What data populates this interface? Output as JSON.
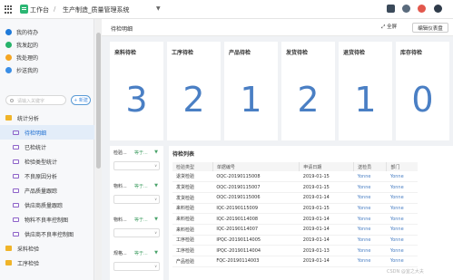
{
  "topbar": {
    "workspace": "工作台",
    "separator": "/",
    "system": "生产制造_质量管理系统",
    "icons": [
      "grid-icon",
      "document-icon",
      "user-icon",
      "notification-icon",
      "help-icon"
    ]
  },
  "sidebar": {
    "top_items": [
      {
        "label": "我的待办",
        "color": "#1f7ad9"
      },
      {
        "label": "我发起的",
        "color": "#27b36b"
      },
      {
        "label": "我处理的",
        "color": "#f5a623"
      },
      {
        "label": "抄送我的",
        "color": "#3a8ee6"
      }
    ],
    "search_placeholder": "请输入关键字",
    "new_button": "+ 新建",
    "tree": [
      {
        "label": "统计分析",
        "type": "group"
      },
      {
        "label": "待检明细",
        "type": "child",
        "active": true
      },
      {
        "label": "已检统计",
        "type": "child"
      },
      {
        "label": "检验类型统计",
        "type": "child"
      },
      {
        "label": "不良原因分析",
        "type": "child"
      },
      {
        "label": "产品质量跟踪",
        "type": "child"
      },
      {
        "label": "供应商质量跟踪",
        "type": "child"
      },
      {
        "label": "物料不良率控制图",
        "type": "child"
      },
      {
        "label": "供应商不良率控制图",
        "type": "child"
      },
      {
        "label": "采料检验",
        "type": "group"
      },
      {
        "label": "工序检验",
        "type": "group"
      }
    ]
  },
  "main": {
    "header_title": "待检明细",
    "full_screen": "全屏",
    "edit_dashboard": "编辑仪表盘",
    "cards": [
      {
        "label": "来料待检",
        "value": "3"
      },
      {
        "label": "工序待检",
        "value": "2"
      },
      {
        "label": "产品待检",
        "value": "1"
      },
      {
        "label": "发货待检",
        "value": "2"
      },
      {
        "label": "退货待检",
        "value": "1"
      },
      {
        "label": "库存待检",
        "value": "0"
      }
    ],
    "filters": [
      {
        "field": "检验...",
        "op": "等于..."
      },
      {
        "field": "物料...",
        "op": "等于..."
      },
      {
        "field": "物料...",
        "op": "等于..."
      },
      {
        "field": "规格...",
        "op": "等于..."
      }
    ],
    "list": {
      "title": "待检列表",
      "columns": [
        "检验类型",
        "单据编号",
        "申请日期",
        "送检员",
        "部门"
      ],
      "rows": [
        [
          "退货检验",
          "OQC-20190115008",
          "2019-01-15",
          "Yonne",
          "Yonne"
        ],
        [
          "发货检验",
          "OQC-20190115007",
          "2019-01-15",
          "Yonne",
          "Yonne"
        ],
        [
          "发货检验",
          "OQC-20190115006",
          "2019-01-14",
          "Yonne",
          "Yonne"
        ],
        [
          "来料检验",
          "IQC-20190115009",
          "2019-01-15",
          "Yonne",
          "Yonne"
        ],
        [
          "来料检验",
          "IQC-20190114008",
          "2019-01-14",
          "Yonne",
          "Yonne"
        ],
        [
          "来料检验",
          "IQC-20190114007",
          "2019-01-14",
          "Yonne",
          "Yonne"
        ],
        [
          "工序检验",
          "IPQC-20190114005",
          "2019-01-14",
          "Yonne",
          "Yonne"
        ],
        [
          "工序检验",
          "IPQC-20190114004",
          "2019-01-13",
          "Yonne",
          "Yonne"
        ],
        [
          "产品检验",
          "FQC-20190114003",
          "2019-01-14",
          "Yonne",
          "Yonne"
        ]
      ]
    }
  },
  "watermark": "CSDN @宜之大夫"
}
